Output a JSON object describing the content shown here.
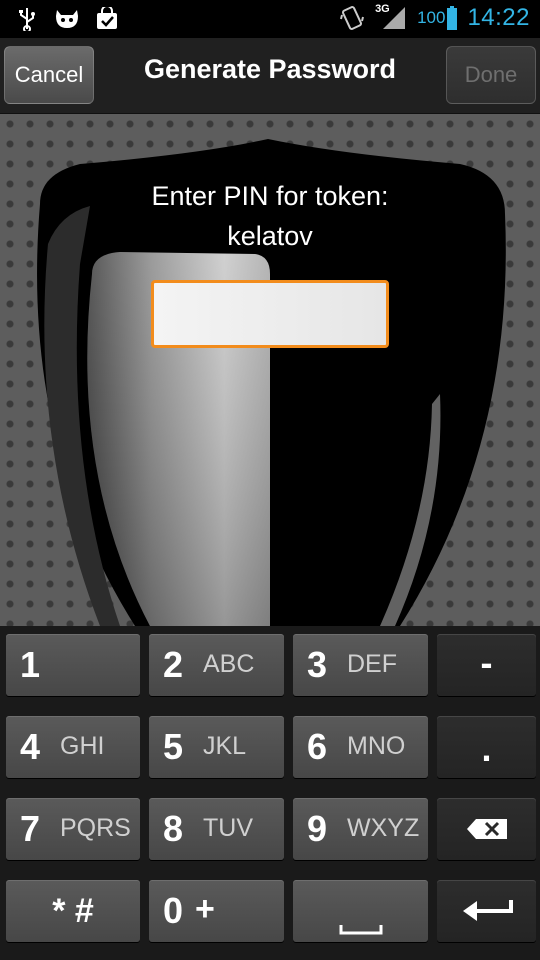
{
  "status_bar": {
    "battery_level": "100",
    "network": "3G",
    "time": "14:22",
    "icons": [
      "usb-icon",
      "android-debug-icon",
      "download-complete-icon",
      "vibrate-icon",
      "signal-icon",
      "battery-icon"
    ]
  },
  "action_bar": {
    "cancel_label": "Cancel",
    "title": "Generate Password",
    "done_label": "Done"
  },
  "prompt": {
    "line1": "Enter PIN for token:",
    "line2": "kelatov"
  },
  "pin_input": {
    "value": "",
    "placeholder": ""
  },
  "keypad": {
    "k1": {
      "num": "1",
      "letters": ""
    },
    "k2": {
      "num": "2",
      "letters": "ABC"
    },
    "k3": {
      "num": "3",
      "letters": "DEF"
    },
    "k4": {
      "num": "4",
      "letters": "GHI"
    },
    "k5": {
      "num": "5",
      "letters": "JKL"
    },
    "k6": {
      "num": "6",
      "letters": "MNO"
    },
    "k7": {
      "num": "7",
      "letters": "PQRS"
    },
    "k8": {
      "num": "8",
      "letters": "TUV"
    },
    "k9": {
      "num": "9",
      "letters": "WXYZ"
    },
    "k0": {
      "num": "0",
      "letters": "+"
    },
    "star_hash": "* #",
    "minus": "-",
    "dot": ".",
    "backspace_icon": "backspace-icon",
    "space_icon": "space-icon",
    "enter_icon": "enter-icon"
  },
  "colors": {
    "accent_blue": "#33b5e5",
    "input_border": "#f28c1c",
    "action_bar": "#202020",
    "keypad_bg": "#1a1a1a"
  }
}
